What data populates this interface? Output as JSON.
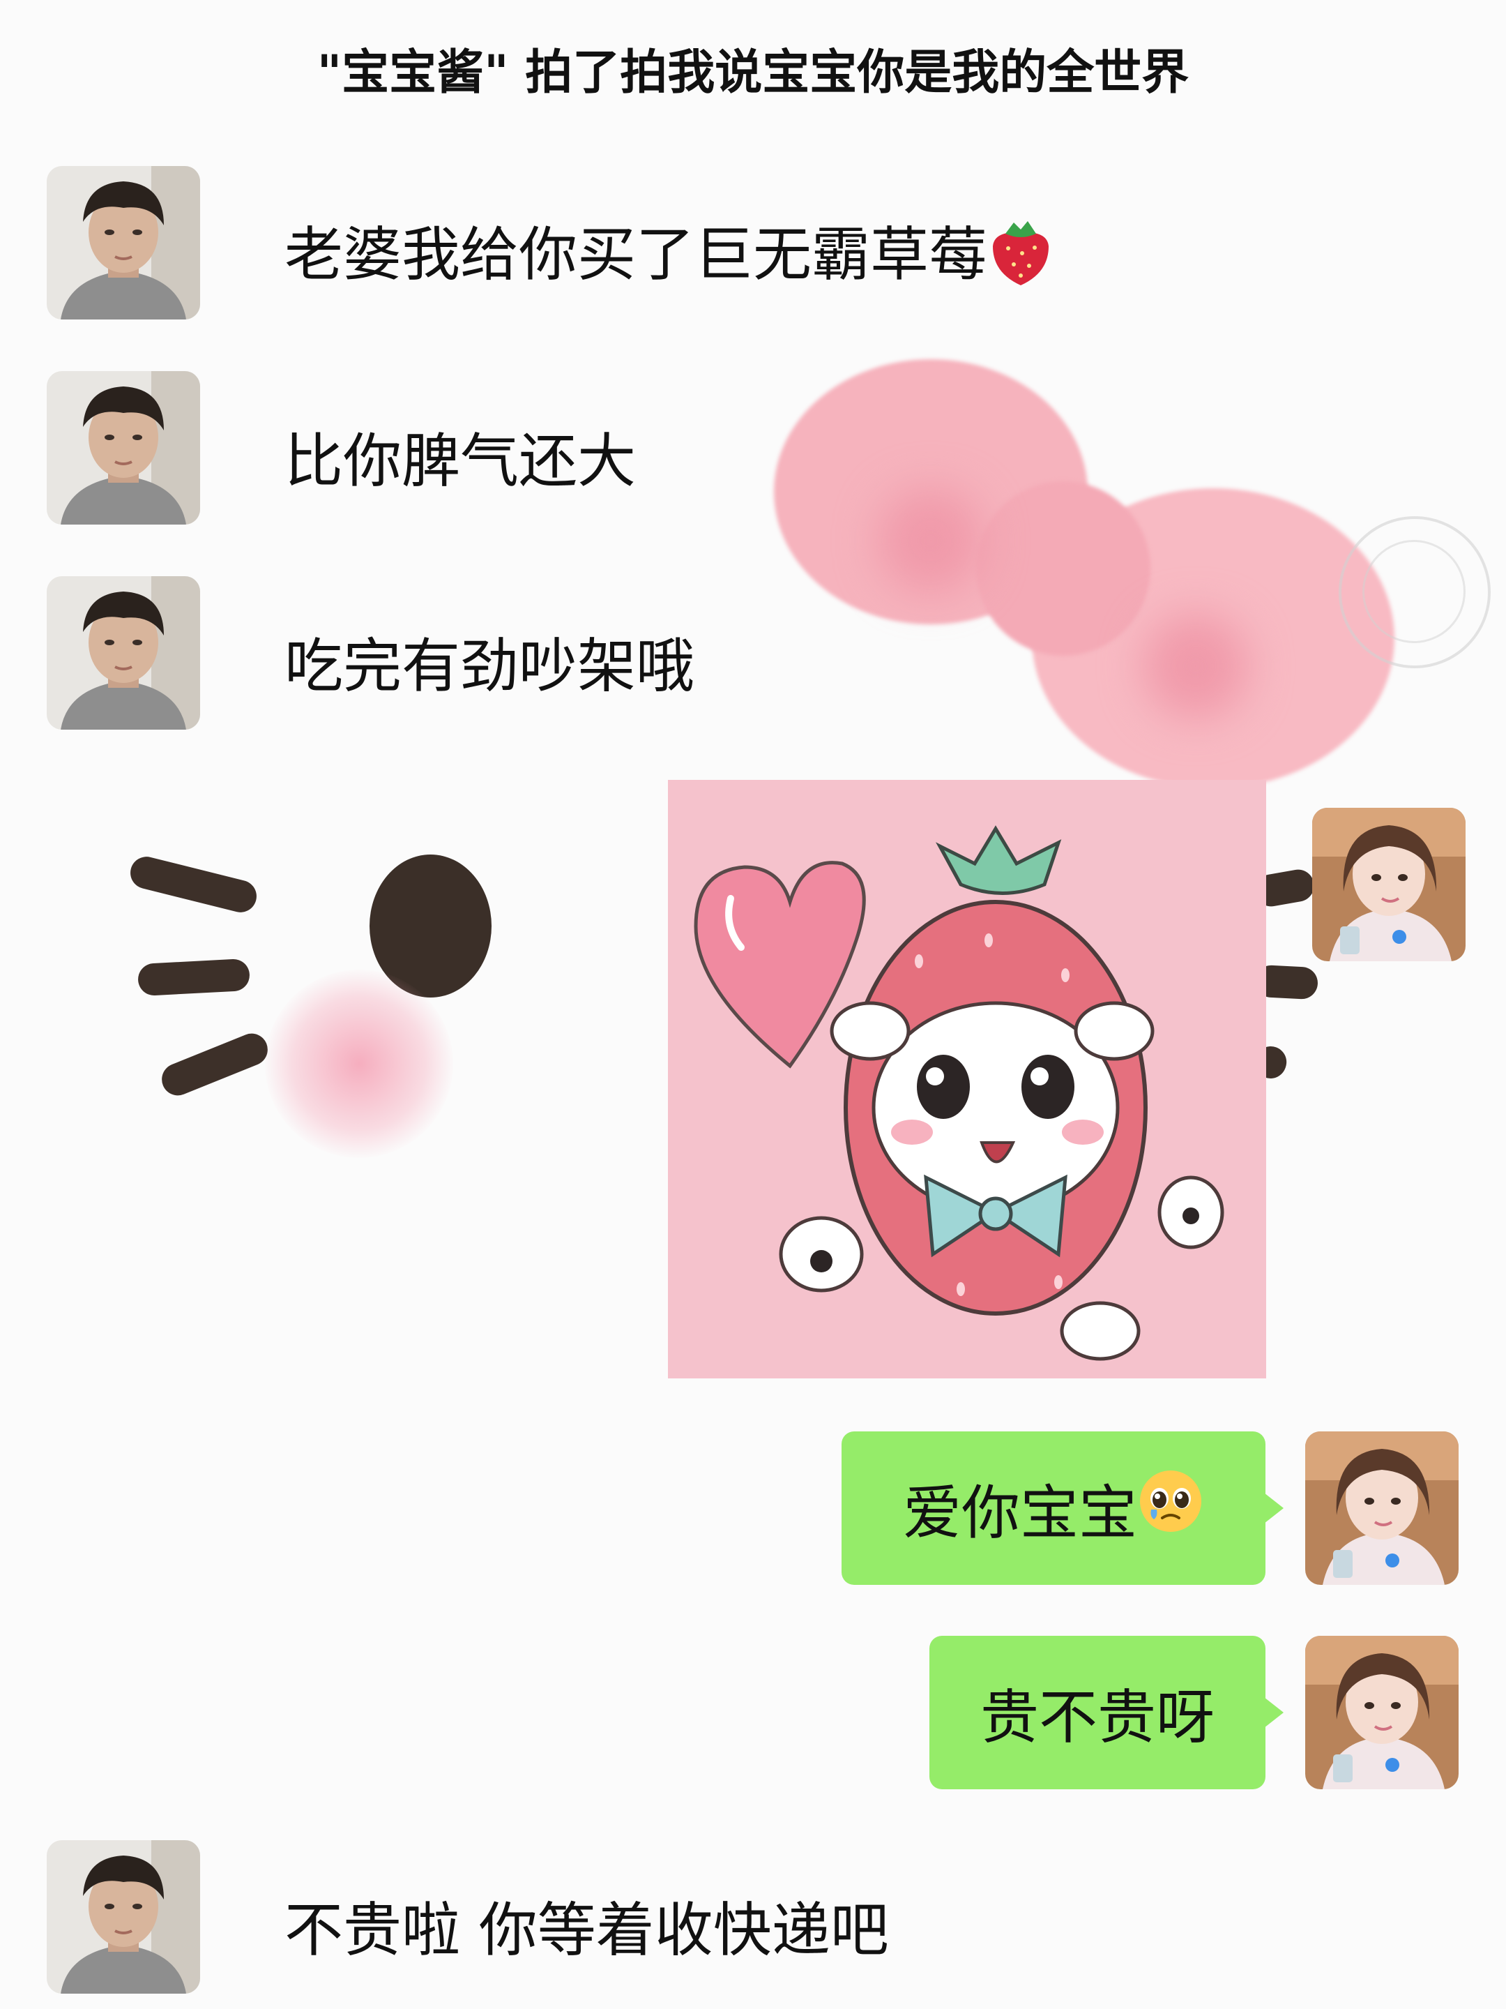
{
  "title": "\"宝宝酱\" 拍了拍我说宝宝你是我的全世界",
  "messages": [
    {
      "sender": "boyfriend",
      "text": "老婆我给你买了巨无霸草莓",
      "emoji": "strawberry-icon"
    },
    {
      "sender": "boyfriend",
      "text": "比你脾气还大"
    },
    {
      "sender": "boyfriend",
      "text": "吃完有劲吵架哦"
    },
    {
      "sender": "girlfriend",
      "type": "sticker",
      "sticker": "strawberry-puppy-sticker"
    },
    {
      "sender": "girlfriend",
      "text": "爱你宝宝",
      "emoji": "pleading-face-icon"
    },
    {
      "sender": "girlfriend",
      "text": "贵不贵呀"
    },
    {
      "sender": "boyfriend",
      "text": "不贵啦 你等着收快递吧"
    }
  ],
  "colors": {
    "sent_bubble": "#95ec69",
    "background": "#fbfbfb",
    "bow_pink": "#f6b3bd",
    "sticker_background": "#f5c2cc"
  }
}
